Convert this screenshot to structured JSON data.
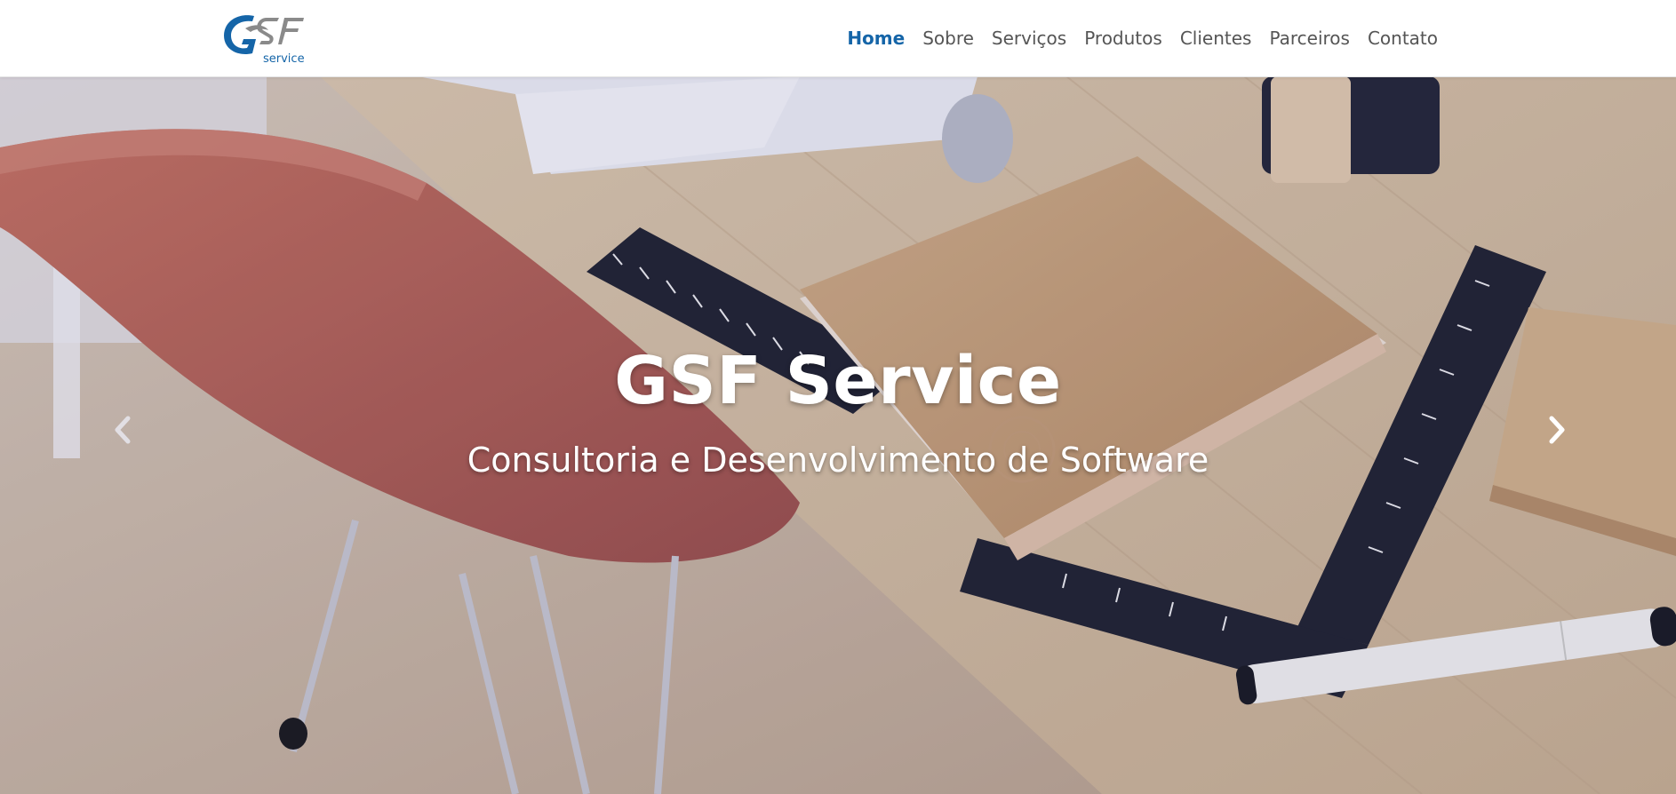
{
  "brand": {
    "logo_text": "GSF",
    "logo_subtext": "service",
    "logo_colors": {
      "primary": "#1565a8",
      "secondary": "#8a8a8a"
    }
  },
  "nav": {
    "items": [
      {
        "label": "Home",
        "active": true
      },
      {
        "label": "Sobre",
        "active": false
      },
      {
        "label": "Serviços",
        "active": false
      },
      {
        "label": "Produtos",
        "active": false
      },
      {
        "label": "Clientes",
        "active": false
      },
      {
        "label": "Parceiros",
        "active": false
      },
      {
        "label": "Contato",
        "active": false
      }
    ],
    "active_color": "#1565a8",
    "text_color": "#555555"
  },
  "hero": {
    "title": "GSF Service",
    "subtitle": "Consultoria e Desenvolvimento de Software",
    "prev_icon": "chevron-left-icon",
    "next_icon": "chevron-right-icon"
  }
}
